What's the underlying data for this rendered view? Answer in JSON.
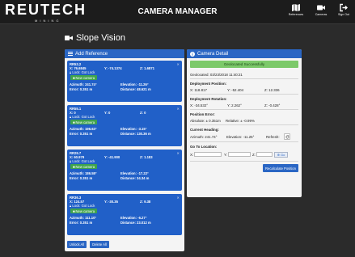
{
  "header": {
    "logo_word": "REUTECH",
    "logo_sub": "MINING",
    "title": "CAMERA MANAGER",
    "nav": [
      {
        "label": "References",
        "icon": "map-icon"
      },
      {
        "label": "Cameras",
        "icon": "video-camera-icon"
      },
      {
        "label": "Sign Out",
        "icon": "sign-out-icon"
      }
    ]
  },
  "page_heading": "Slope Vision",
  "add_reference": {
    "title": "Add Reference",
    "references": [
      {
        "name": "RR53.2",
        "x": "X: 76.6845",
        "y": "Y: -74.1374",
        "z": "Z: 1.6871",
        "lock": "Lock: Got Lock",
        "camera_tag": "New camera",
        "azimuth": "Azimuth: 241.74°",
        "elevation": "Elevation: -11.26°",
        "error": "Error: 0.351 m",
        "distance": "Distance: 48.621 m"
      },
      {
        "name": "RR55.1",
        "x": "X: 0",
        "y": "Y: 0",
        "z": "Z: 0",
        "lock": "Lock: Got Lock",
        "camera_tag": "New camera",
        "azimuth": "Azimuth: 196.63°",
        "elevation": "Elevation: -3.15°",
        "error": "Error: 0.351 m",
        "distance": "Distance: 130.36 m"
      },
      {
        "name": "RR29.7",
        "x": "X: 60.979",
        "y": "Y: -41.900",
        "z": "Z: 1.183",
        "lock": "Lock: Got Lock",
        "camera_tag": "New camera",
        "azimuth": "Azimuth: 186.58°",
        "elevation": "Elevation: -17.22°",
        "error": "Error: 0.351 m",
        "distance": "Distance: 34.34 m"
      },
      {
        "name": "RR36.3",
        "x": "X: 124.57",
        "y": "Y: -30.35",
        "z": "Z: 9.38",
        "lock": "Lock: Got Lock",
        "camera_tag": "New camera",
        "azimuth": "Azimuth: 111.10°",
        "elevation": "Elevation: -6.27°",
        "error": "Error: 0.351 m",
        "distance": "Distance: 23.012 m"
      }
    ],
    "unlock_all": "Unlock All",
    "delete_all": "Delete All"
  },
  "camera_detail": {
    "title": "Camera Detail",
    "success": "Geolocated Successfully",
    "geolocated": "Geolocated: 03/23/2018 11:40:21",
    "deployment_position_label": "Deployment Position:",
    "pos_x": "X: 118.817",
    "pos_y": "Y: -52.404",
    "pos_z": "Z: 12.336",
    "deployment_rotation_label": "Deployment Rotation:",
    "rot_x": "X: -34.532°",
    "rot_y": "Y: 2.262°",
    "rot_z": "Z: -0.428°",
    "position_error_label": "Position Error:",
    "abs_err": "Absolute: ± 0.351m",
    "rel_err": "Relative: ± -0.99%",
    "heading_label": "Current Heading:",
    "heading_az": "Azimuth: 241.74°",
    "heading_el": "Elevation: -11.25°",
    "refresh_label": "Refresh:",
    "goto_label": "Go To Location:",
    "goto_x": "X:",
    "goto_y": "Y:",
    "goto_z": "Z:",
    "go_label": "Go",
    "recalc_label": "Recalculate Position"
  },
  "colors": {
    "accent": "#2a66c4",
    "card": "#2160c8",
    "success": "#7cc96a",
    "camera_tag": "#3fa34d",
    "background": "#2b2b2b",
    "topbar": "#1c1c1c"
  }
}
